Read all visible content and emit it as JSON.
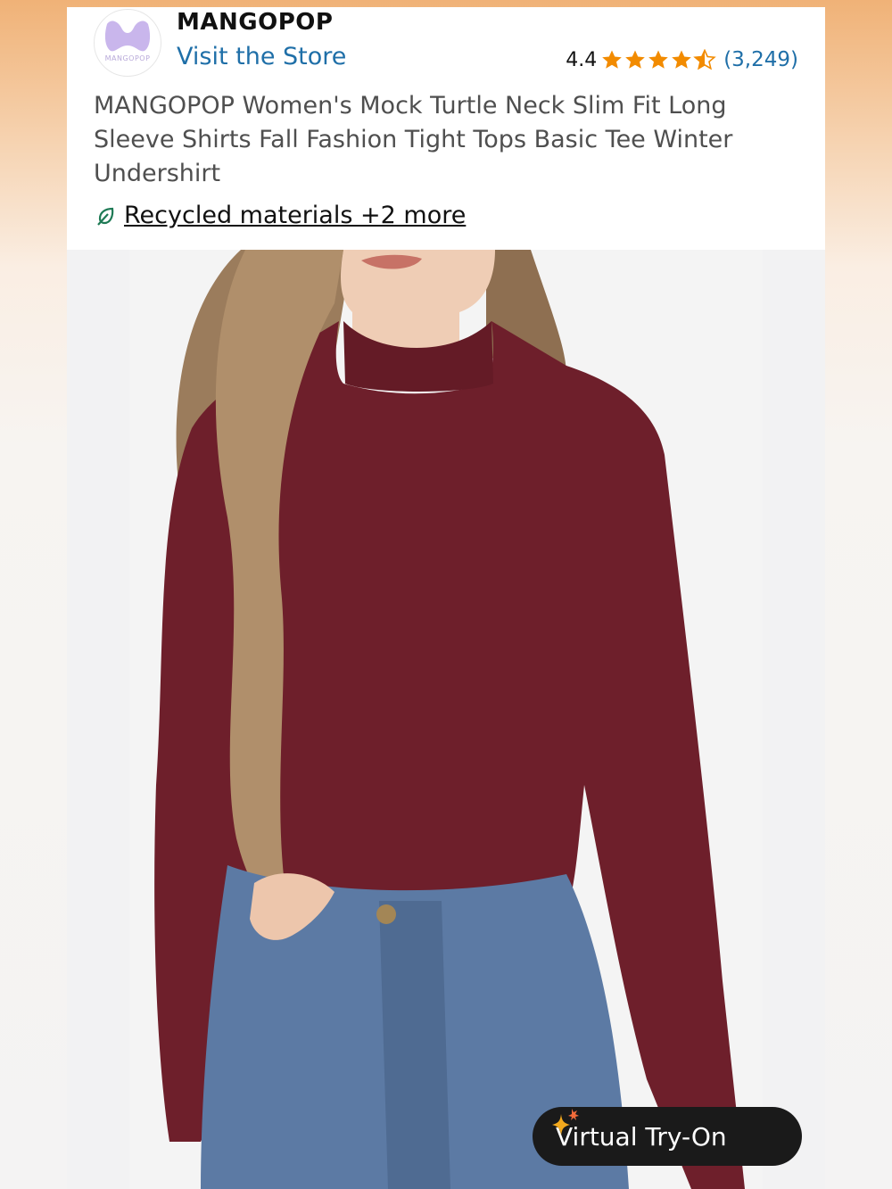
{
  "store": {
    "logo_text": "MANGOPOP",
    "name": "MANGOPOP",
    "visit_label": "Visit the Store"
  },
  "rating": {
    "value": "4.4",
    "stars_out_of_5": 4.4,
    "count": "(3,249)",
    "star_color": "#f28b00"
  },
  "product": {
    "title": "MANGOPOP Women's Mock Turtle Neck Slim Fit Long Sleeve Shirts Fall Fashion Tight Tops Basic Tee Winter Undershirt",
    "sustainability_label": "Recycled materials +2 more",
    "sustainability_icon": "leaf-icon",
    "shirt_color": "#6e1f2b"
  },
  "virtual_try_on": {
    "label": "Virtual Try-On",
    "icon": "sparkle-icon"
  },
  "colors": {
    "link": "#1f6fa8",
    "accent_orange": "#f28b00"
  }
}
